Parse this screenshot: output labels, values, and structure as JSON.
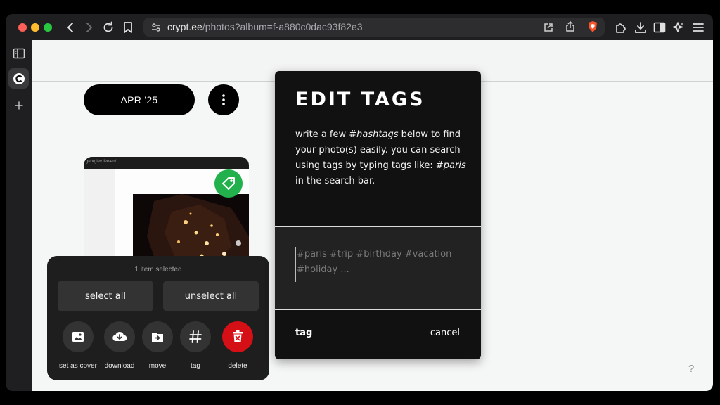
{
  "browser": {
    "url_host": "crypt.ee",
    "url_rest": "/photos?album=f-a880c0dac93f82e3",
    "colors": {
      "chrome": "#1f1f21",
      "address_bar": "#2d2d30",
      "close": "#fe5f57",
      "minimize": "#febc2e",
      "maximize": "#28c840",
      "brave": "#fb542b"
    }
  },
  "album": {
    "month_label": "APR '25",
    "thumbnail_url_text": "georgiev.live/en/"
  },
  "selection": {
    "count_text": "1 item selected",
    "select_all": "select all",
    "unselect_all": "unselect all",
    "actions": {
      "set_as_cover": "set as cover",
      "download": "download",
      "move": "move",
      "tag": "tag",
      "delete": "delete"
    },
    "colors": {
      "delete": "#d41016",
      "tag_badge": "#22b14c"
    }
  },
  "edit_tags": {
    "title": "EDIT TAGS",
    "desc_1": "write a few ",
    "desc_hashtags": "#hashtags",
    "desc_2": " below to find your photo(s) easily. you can search using tags by typing tags like: ",
    "desc_paris": "#paris",
    "desc_3": " in the search bar.",
    "input_value": "",
    "input_placeholder": "#paris #trip #birthday #vacation #holiday ...",
    "tag_button": "tag",
    "cancel_button": "cancel"
  },
  "help_text": "?"
}
